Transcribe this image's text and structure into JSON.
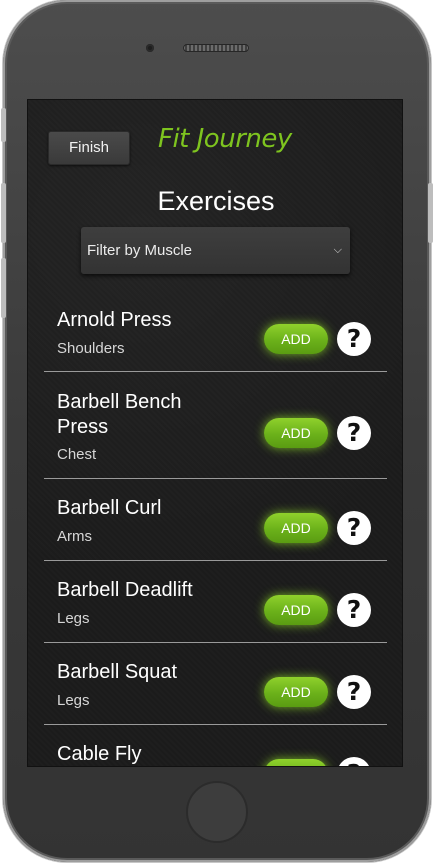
{
  "header": {
    "finish_label": "Finish",
    "brand": "Fit Journey"
  },
  "main": {
    "title": "Exercises",
    "filter": {
      "selected": "Filter by Muscle"
    },
    "exercises": [
      {
        "name": "Arnold Press",
        "group": "Shoulders",
        "add_label": "ADD",
        "help": "?"
      },
      {
        "name": "Barbell Bench Press",
        "group": "Chest",
        "add_label": "ADD",
        "help": "?"
      },
      {
        "name": "Barbell Curl",
        "group": "Arms",
        "add_label": "ADD",
        "help": "?"
      },
      {
        "name": "Barbell Deadlift",
        "group": "Legs",
        "add_label": "ADD",
        "help": "?"
      },
      {
        "name": "Barbell Squat",
        "group": "Legs",
        "add_label": "ADD",
        "help": "?"
      },
      {
        "name": "Cable Fly",
        "group": "",
        "add_label": "ADD",
        "help": "?"
      }
    ]
  },
  "colors": {
    "accent_green": "#7ec41f",
    "background": "#1c1c1c"
  }
}
